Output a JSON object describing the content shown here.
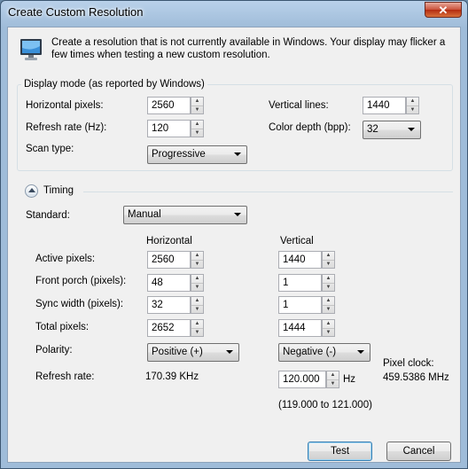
{
  "window": {
    "title": "Create Custom Resolution",
    "close_glyph": "✕"
  },
  "intro": {
    "line1": "Create a resolution that is not currently available in Windows. Your display may flicker a",
    "line2": "few times when testing a new custom resolution."
  },
  "display_mode": {
    "group_label": "Display mode (as reported by Windows)",
    "horizontal_pixels": {
      "label": "Horizontal pixels:",
      "value": "2560"
    },
    "refresh_rate": {
      "label": "Refresh rate (Hz):",
      "value": "120"
    },
    "scan_type": {
      "label": "Scan type:",
      "value": "Progressive"
    },
    "vertical_lines": {
      "label": "Vertical lines:",
      "value": "1440"
    },
    "color_depth": {
      "label": "Color depth (bpp):",
      "value": "32"
    }
  },
  "timing": {
    "label": "Timing",
    "standard": {
      "label": "Standard:",
      "value": "Manual"
    },
    "col_horizontal": "Horizontal",
    "col_vertical": "Vertical",
    "rows": {
      "active": {
        "label": "Active pixels:",
        "h": "2560",
        "v": "1440"
      },
      "front_porch": {
        "label": "Front porch (pixels):",
        "h": "48",
        "v": "1"
      },
      "sync_width": {
        "label": "Sync width (pixels):",
        "h": "32",
        "v": "1"
      },
      "total": {
        "label": "Total pixels:",
        "h": "2652",
        "v": "1444"
      }
    },
    "polarity": {
      "label": "Polarity:",
      "h": "Positive (+)",
      "v": "Negative (-)"
    },
    "refresh": {
      "label": "Refresh rate:",
      "h": "170.39 KHz",
      "v": "120.000",
      "unit": "Hz",
      "range": "(119.000 to 121.000)"
    },
    "pixel_clock": {
      "label": "Pixel clock:",
      "value": "459.5386 MHz"
    }
  },
  "buttons": {
    "test": "Test",
    "cancel": "Cancel"
  },
  "colors": {
    "accent": "#3c7fb1",
    "title_bar": "#9fbcd9",
    "close": "#c9503a"
  }
}
